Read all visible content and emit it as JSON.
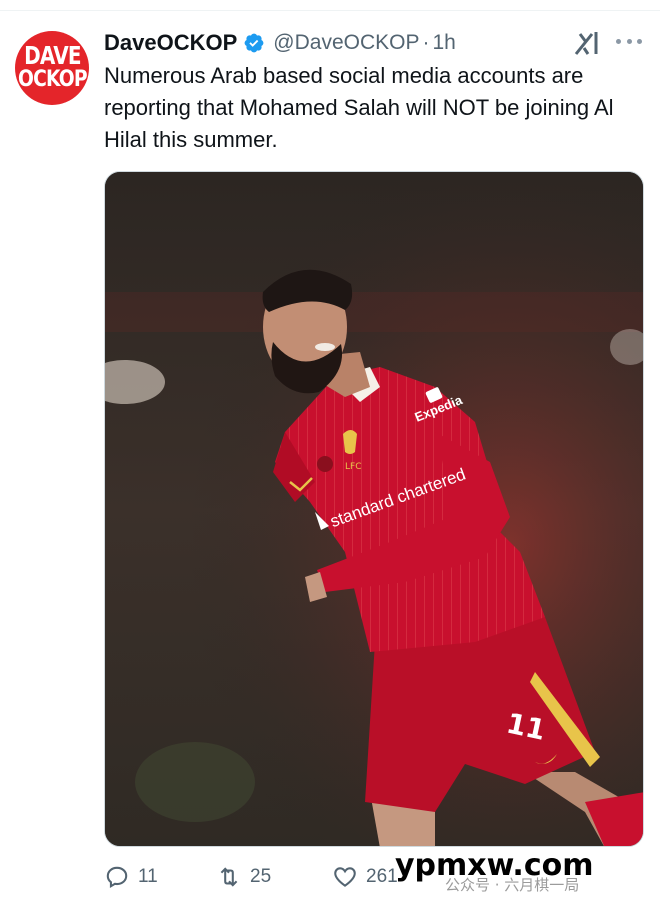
{
  "author": {
    "display_name": "DaveOCKOP",
    "handle": "@DaveOCKOP",
    "separator": "·",
    "time": "1h",
    "avatar_lines": [
      "DAVE",
      "OCKOP"
    ],
    "avatar_color": "#e4252a"
  },
  "tweet": {
    "text": "Numerous Arab based social media accounts are reporting that Mohamed Salah will NOT be joining Al Hilal this summer."
  },
  "media": {
    "shirt_sponsor": "standard chartered",
    "sleeve_sponsor": "Expedia",
    "crest_text": "LFC",
    "shorts_number": "11",
    "kit_color": "#c8102e"
  },
  "actions": {
    "replies": "11",
    "reposts": "25",
    "likes": "261"
  },
  "watermark": {
    "site": "ypmxw.com",
    "overlay": "公众号 · 六月棋一局"
  },
  "icons": [
    "verified-badge-icon",
    "grok-icon",
    "more-icon",
    "reply-icon",
    "repost-icon",
    "like-icon"
  ]
}
